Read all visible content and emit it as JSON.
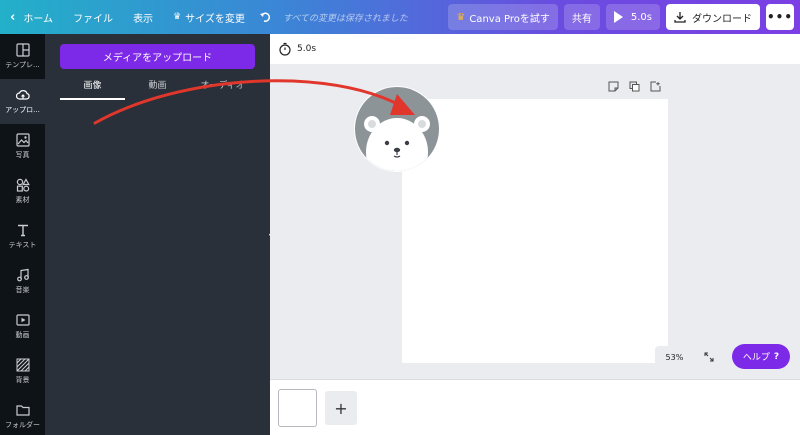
{
  "topbar": {
    "home": "ホーム",
    "file": "ファイル",
    "view": "表示",
    "resize": "サイズを変更",
    "saved_status": "すべての変更は保存されました",
    "canva_pro": "Canva Proを試す",
    "share": "共有",
    "play_duration": "5.0s",
    "download": "ダウンロード",
    "more": "•••"
  },
  "rail": {
    "items": [
      {
        "label": "テンプレ...",
        "icon": "template-icon"
      },
      {
        "label": "アップロ...",
        "icon": "upload-icon"
      },
      {
        "label": "写真",
        "icon": "photo-icon"
      },
      {
        "label": "素材",
        "icon": "elements-icon"
      },
      {
        "label": "テキスト",
        "icon": "text-icon"
      },
      {
        "label": "音楽",
        "icon": "music-icon"
      },
      {
        "label": "動画",
        "icon": "video-icon"
      },
      {
        "label": "背景",
        "icon": "background-icon"
      },
      {
        "label": "フォルダー",
        "icon": "folder-icon"
      }
    ]
  },
  "panel": {
    "upload_button": "メディアをアップロード",
    "tabs": [
      "画像",
      "動画",
      "オーディオ"
    ],
    "active_tab": 0
  },
  "editor": {
    "duration": "5.0s",
    "zoom": "53%",
    "help": "ヘルプ",
    "help_icon": "?",
    "add_page": "+"
  },
  "colors": {
    "accent": "#7d2ae8",
    "arrow": "#e0362b"
  }
}
